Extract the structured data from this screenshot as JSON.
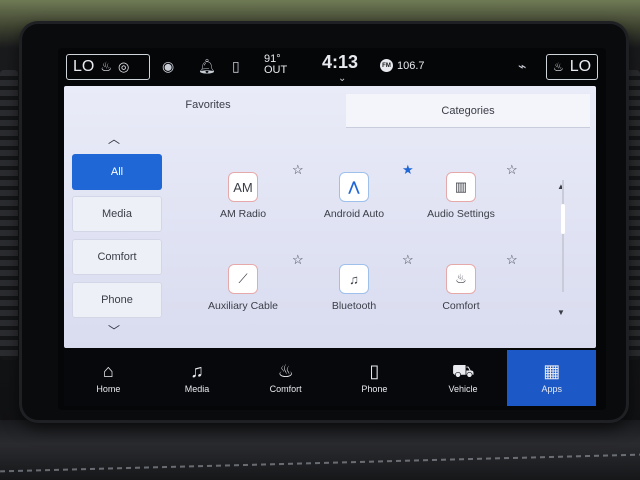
{
  "status_bar": {
    "left_climate": "LO",
    "temp_value": "91°",
    "temp_label": "OUT",
    "time": "4:13",
    "radio_band": "FM",
    "radio_freq": "106.7",
    "right_climate": "LO"
  },
  "tabs": [
    {
      "label": "Favorites"
    },
    {
      "label": "Categories"
    }
  ],
  "sidebar": {
    "items": [
      {
        "label": "All",
        "active": true
      },
      {
        "label": "Media"
      },
      {
        "label": "Comfort"
      },
      {
        "label": "Phone"
      }
    ]
  },
  "apps": [
    {
      "icon_text": "AM",
      "label": "AM Radio",
      "favorite": false
    },
    {
      "icon": "android-auto-icon",
      "label": "Android Auto",
      "favorite": true
    },
    {
      "icon": "audio-settings-icon",
      "label": "Audio Settings",
      "favorite": false
    },
    {
      "icon": "auxiliary-cable-icon",
      "label": "Auxiliary Cable",
      "favorite": false
    },
    {
      "icon": "bluetooth-icon",
      "label": "Bluetooth",
      "favorite": false
    },
    {
      "icon": "comfort-icon",
      "label": "Comfort",
      "favorite": false
    }
  ],
  "nav": [
    {
      "label": "Home",
      "icon": "home-icon"
    },
    {
      "label": "Media",
      "icon": "music-note-icon"
    },
    {
      "label": "Comfort",
      "icon": "seat-heat-icon"
    },
    {
      "label": "Phone",
      "icon": "phone-icon"
    },
    {
      "label": "Vehicle",
      "icon": "car-icon"
    },
    {
      "label": "Apps",
      "icon": "grid-icon",
      "active": true
    }
  ],
  "colors": {
    "accent": "#1f66d6",
    "nav_active": "#1d58c7",
    "content_bg": "#e9ebf8"
  }
}
